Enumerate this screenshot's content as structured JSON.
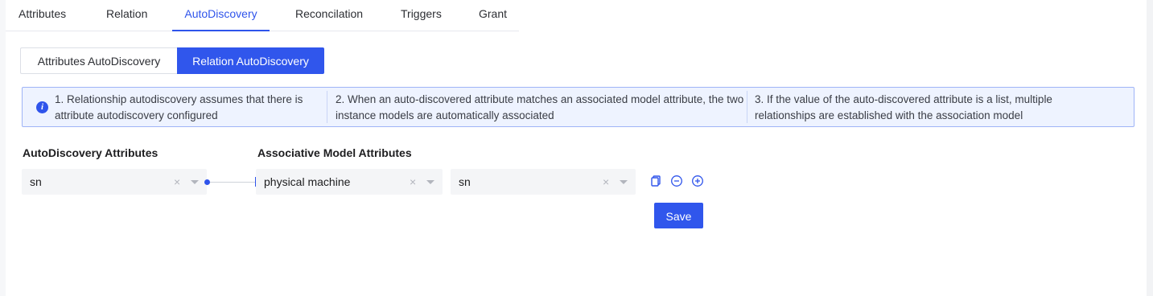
{
  "tabs": {
    "attributes": "Attributes",
    "relation": "Relation",
    "autodiscovery": "AutoDiscovery",
    "reconcilation": "Reconcilation",
    "triggers": "Triggers",
    "grant": "Grant",
    "active": "AutoDiscovery"
  },
  "subtabs": {
    "attributes_autodiscovery": "Attributes AutoDiscovery",
    "relation_autodiscovery": "Relation AutoDiscovery",
    "active": "Relation AutoDiscovery"
  },
  "info": {
    "icon": "info-icon",
    "tip1": "1. Relationship autodiscovery assumes that there is attribute autodiscovery configured",
    "tip2": "2. When an auto-discovered attribute matches an associated model attribute, the two instance models are automatically associated",
    "tip3": "3. If the value of the auto-discovered attribute is a list, multiple relationships are established with the association model"
  },
  "form": {
    "autodiscovery_label": "AutoDiscovery Attributes",
    "associative_label": "Associative Model Attributes",
    "autodiscovery_value": "sn",
    "model_value": "physical machine",
    "model_attr_value": "sn",
    "clear_glyph": "×",
    "save_label": "Save"
  },
  "icons": {
    "copy": "copy-icon",
    "remove": "minus-circle-icon",
    "add": "plus-circle-icon"
  },
  "colors": {
    "primary": "#3056ec",
    "info_bg": "#eef3ff",
    "info_border": "#9fb4f7",
    "select_bg": "#f4f5f7"
  }
}
